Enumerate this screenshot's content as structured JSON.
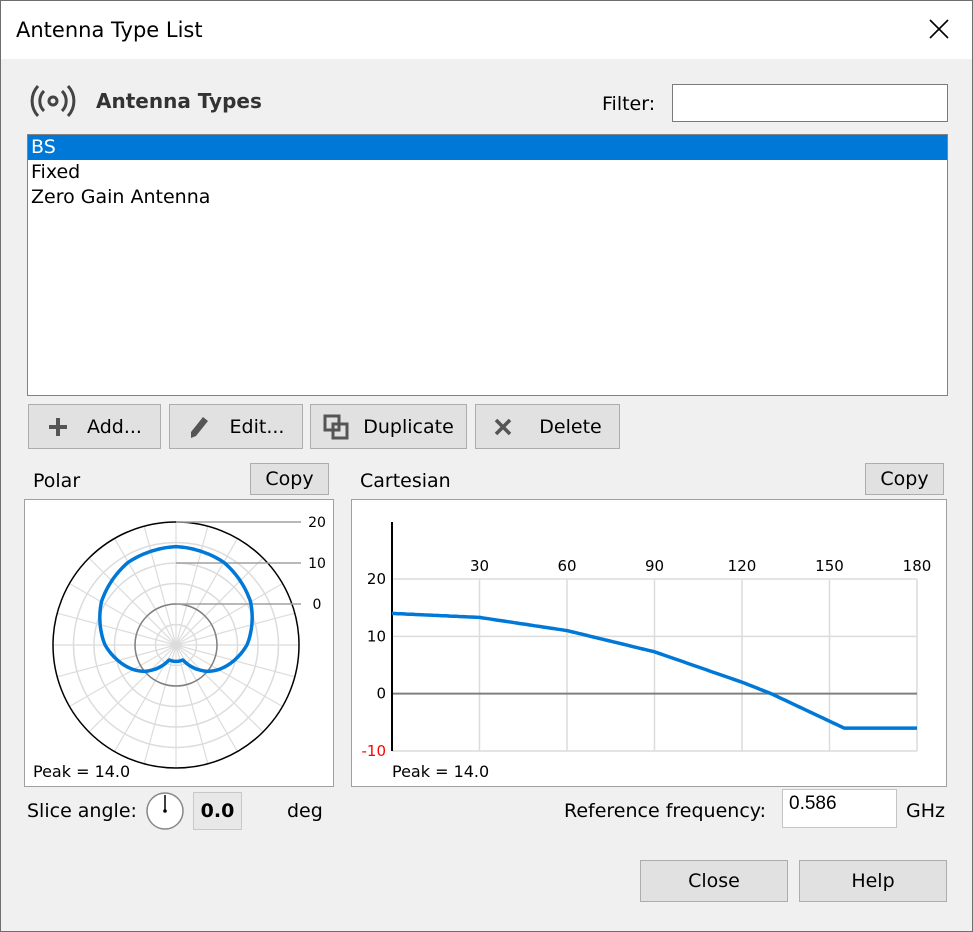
{
  "window": {
    "title": "Antenna Type List",
    "close_icon": "close-x-icon"
  },
  "header": {
    "icon": "antenna-broadcast-icon",
    "heading": "Antenna Types",
    "filter_label": "Filter:",
    "filter_value": ""
  },
  "list": {
    "items": [
      {
        "label": "BS",
        "selected": true
      },
      {
        "label": "Fixed",
        "selected": false
      },
      {
        "label": "Zero Gain Antenna",
        "selected": false
      }
    ]
  },
  "actions": {
    "add": {
      "label": "Add...",
      "icon": "plus-icon"
    },
    "edit": {
      "label": "Edit...",
      "icon": "pencil-icon"
    },
    "duplicate": {
      "label": "Duplicate",
      "icon": "duplicate-icon"
    },
    "delete": {
      "label": "Delete",
      "icon": "x-delete-icon"
    }
  },
  "polar": {
    "label": "Polar",
    "copy_label": "Copy",
    "peak_text": "Peak = 14.0"
  },
  "cartesian": {
    "label": "Cartesian",
    "copy_label": "Copy",
    "peak_text": "Peak = 14.0"
  },
  "slice": {
    "label": "Slice angle:",
    "value": "0.0",
    "unit": "deg"
  },
  "reference": {
    "label": "Reference frequency:",
    "value": "0.586",
    "unit": "GHz"
  },
  "footer": {
    "close_label": "Close",
    "help_label": "Help"
  },
  "colors": {
    "accent": "#0078d7",
    "negative_tick": "#ff0000"
  },
  "chart_data": [
    {
      "type": "line",
      "name": "polar",
      "title": "Polar",
      "radial_ticks": [
        0,
        10,
        20
      ],
      "radial_range": [
        -10,
        20
      ],
      "annotation": "Peak = 14.0",
      "x": [
        0,
        30,
        60,
        90,
        120,
        130,
        155,
        180
      ],
      "values": [
        14.0,
        13.3,
        11.0,
        7.3,
        2.0,
        0.0,
        -6.0,
        -6.0
      ]
    },
    {
      "type": "line",
      "name": "cartesian",
      "title": "Cartesian",
      "xlabel": "",
      "ylabel": "",
      "x_ticks": [
        30,
        60,
        90,
        120,
        150,
        180
      ],
      "y_ticks": [
        -10,
        0,
        10,
        20
      ],
      "xlim": [
        0,
        180
      ],
      "ylim": [
        -10,
        20
      ],
      "grid": true,
      "annotation": "Peak = 14.0",
      "x": [
        0,
        30,
        60,
        90,
        120,
        130,
        155,
        180
      ],
      "values": [
        14.0,
        13.3,
        11.0,
        7.3,
        2.0,
        0.0,
        -6.0,
        -6.0
      ]
    }
  ]
}
